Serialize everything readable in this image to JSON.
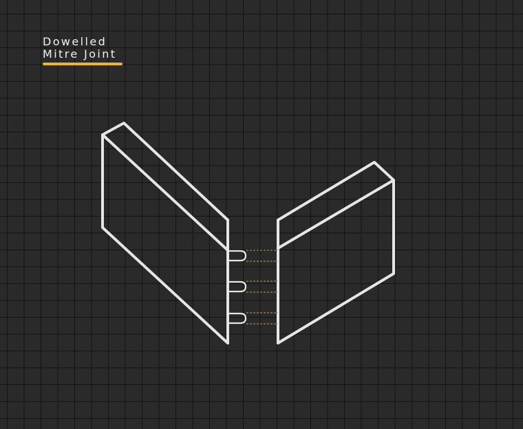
{
  "title": {
    "line1": "Dowelled",
    "line2": "Mitre Joint"
  },
  "colors": {
    "background": "#2a2a2a",
    "grid": "#141414",
    "outline": "#e6e6e6",
    "accent": "#f0b429",
    "dowel_guide": "#a88a3a"
  },
  "dowel_count": 3
}
